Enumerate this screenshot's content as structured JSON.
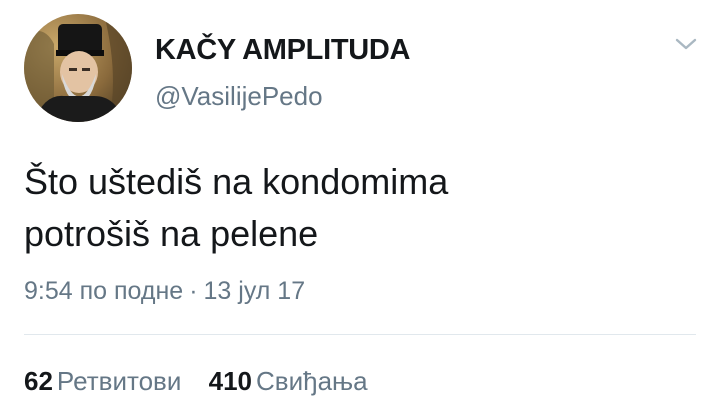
{
  "author": {
    "display_name": "KAČY AMPLITUDA",
    "handle": "@VasilijePedo",
    "avatar_icon": "profile-photo"
  },
  "tweet": {
    "lines": [
      "Što uštediš na kondomima",
      "potrošiš na pelene"
    ],
    "time": "9:54 по подне",
    "separator": "·",
    "date": "13 јул 17"
  },
  "stats": {
    "retweets_count": "62",
    "retweets_label": "Ретвитови",
    "likes_count": "410",
    "likes_label": "Свиђања"
  },
  "colors": {
    "text": "#14171a",
    "secondary": "#657786",
    "divider": "#e1e8ed",
    "caret": "#aab8c2"
  },
  "icons": {
    "menu": "chevron-down-icon"
  }
}
